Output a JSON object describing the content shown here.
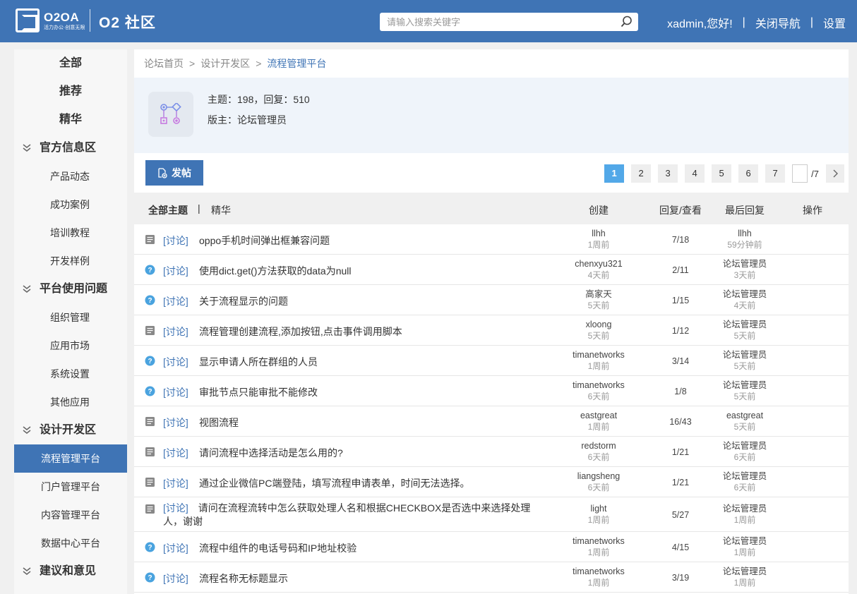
{
  "header": {
    "logo_name": "O2OA",
    "logo_slogan": "活力办公·创意无限",
    "site_name": "O2 社区",
    "search_placeholder": "请输入搜索关键字",
    "greeting": "xadmin,您好!",
    "sep": "|",
    "close_nav": "关闭导航",
    "settings": "设置"
  },
  "sidebar": {
    "top": [
      "全部",
      "推荐",
      "精华"
    ],
    "groups": [
      {
        "label": "官方信息区",
        "items": [
          "产品动态",
          "成功案例",
          "培训教程",
          "开发样例"
        ]
      },
      {
        "label": "平台使用问题",
        "items": [
          "组织管理",
          "应用市场",
          "系统设置",
          "其他应用"
        ]
      },
      {
        "label": "设计开发区",
        "items": [
          "流程管理平台",
          "门户管理平台",
          "内容管理平台",
          "数据中心平台"
        ]
      },
      {
        "label": "建议和意见",
        "items": []
      }
    ],
    "active_item": "流程管理平台"
  },
  "breadcrumb": {
    "home": "论坛首页",
    "sep": ">",
    "section": "设计开发区",
    "current": "流程管理平台"
  },
  "forum": {
    "stats": "主题：198，回复：510",
    "moderator": "版主：论坛管理员"
  },
  "toolbar": {
    "post_label": "发帖",
    "pages": [
      "1",
      "2",
      "3",
      "4",
      "5",
      "6",
      "7"
    ],
    "current_page": "1",
    "page_total": "/7"
  },
  "table": {
    "tab_all": "全部主题",
    "tab_sep": "|",
    "tab_essence": "精华",
    "col_create": "创建",
    "col_reply": "回复/查看",
    "col_last": "最后回复",
    "col_action": "操作",
    "rows": [
      {
        "icon": "doc",
        "cat": "[讨论]",
        "title": "oppo手机时间弹出框兼容问题",
        "creator": "llhh",
        "created": "1周前",
        "reply": "7/18",
        "last_user": "llhh",
        "last_time": "59分钟前"
      },
      {
        "icon": "question",
        "cat": "[讨论]",
        "title": "使用dict.get()方法获取的data为null",
        "creator": "chenxyu321",
        "created": "4天前",
        "reply": "2/11",
        "last_user": "论坛管理员",
        "last_time": "3天前"
      },
      {
        "icon": "question",
        "cat": "[讨论]",
        "title": "关于流程显示的问题",
        "creator": "高家天",
        "created": "5天前",
        "reply": "1/15",
        "last_user": "论坛管理员",
        "last_time": "4天前"
      },
      {
        "icon": "doc",
        "cat": "[讨论]",
        "title": "流程管理创建流程,添加按钮,点击事件调用脚本",
        "creator": "xloong",
        "created": "5天前",
        "reply": "1/12",
        "last_user": "论坛管理员",
        "last_time": "5天前"
      },
      {
        "icon": "question",
        "cat": "[讨论]",
        "title": "显示申请人所在群组的人员",
        "creator": "timanetworks",
        "created": "1周前",
        "reply": "3/14",
        "last_user": "论坛管理员",
        "last_time": "5天前"
      },
      {
        "icon": "question",
        "cat": "[讨论]",
        "title": "审批节点只能审批不能修改",
        "creator": "timanetworks",
        "created": "6天前",
        "reply": "1/8",
        "last_user": "论坛管理员",
        "last_time": "5天前"
      },
      {
        "icon": "doc",
        "cat": "[讨论]",
        "title": "视图流程",
        "creator": "eastgreat",
        "created": "1周前",
        "reply": "16/43",
        "last_user": "eastgreat",
        "last_time": "5天前"
      },
      {
        "icon": "doc",
        "cat": "[讨论]",
        "title": "请问流程中选择活动是怎么用的?",
        "creator": "redstorm",
        "created": "6天前",
        "reply": "1/21",
        "last_user": "论坛管理员",
        "last_time": "6天前"
      },
      {
        "icon": "doc",
        "cat": "[讨论]",
        "title": "通过企业微信PC端登陆，填写流程申请表单，时间无法选择。",
        "creator": "liangsheng",
        "created": "6天前",
        "reply": "1/21",
        "last_user": "论坛管理员",
        "last_time": "6天前"
      },
      {
        "icon": "doc",
        "cat": "[讨论]",
        "title": "请问在流程流转中怎么获取处理人名和根据CHECKBOX是否选中来选择处理人，谢谢",
        "creator": "light",
        "created": "1周前",
        "reply": "5/27",
        "last_user": "论坛管理员",
        "last_time": "1周前",
        "tall": true
      },
      {
        "icon": "question",
        "cat": "[讨论]",
        "title": "流程中组件的电话号码和IP地址校验",
        "creator": "timanetworks",
        "created": "1周前",
        "reply": "4/15",
        "last_user": "论坛管理员",
        "last_time": "1周前"
      },
      {
        "icon": "question",
        "cat": "[讨论]",
        "title": "流程名称无标题显示",
        "creator": "timanetworks",
        "created": "1周前",
        "reply": "3/19",
        "last_user": "论坛管理员",
        "last_time": "1周前"
      }
    ]
  },
  "colors": {
    "brand": "#3f74b5",
    "page_active": "#52a8e8",
    "question_icon": "#4aa3df",
    "doc_icon": "#888888"
  }
}
